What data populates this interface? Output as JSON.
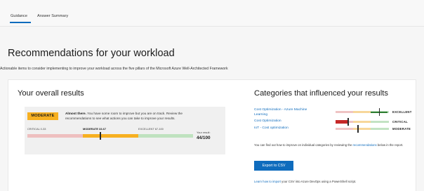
{
  "tabs": [
    {
      "label": "Guidance",
      "active": true
    },
    {
      "label": "Answer Summary",
      "active": false
    }
  ],
  "page": {
    "title": "Recommendations for your workload",
    "subtitle": "Actionable items to consider implementing to improve your workload across the five pillars of the Microsoft Azure Well-Architected Framework"
  },
  "results": {
    "title": "Your overall results",
    "badge": "MODERATE",
    "summary_bold": "Almost there.",
    "summary_rest": " You have some room to improve but you are on track. Review the recommendations to see what actions you can take to improve your results.",
    "scale": {
      "critical": "CRITICAL 0-33",
      "moderate": "MODERATE 33-67",
      "excellent": "EXCELLENT 67-100"
    },
    "your_result_label": "Your result:",
    "your_result_value": "44/100",
    "score": 44,
    "max": 100
  },
  "categories": {
    "title": "Categories that influenced your results",
    "items": [
      {
        "name": "Cost Optimization - Azure Machine",
        "name_cont": "Learning",
        "status": "EXCELLENT",
        "score": 0.82,
        "color": "#2e7d32"
      },
      {
        "name": "Cost Optimization",
        "status": "CRITICAL",
        "score": 0.24,
        "color": "#c62828"
      },
      {
        "name": "IoT - Cost optimization",
        "status": "MODERATE",
        "score": 0.42,
        "color": "#f7b021"
      }
    ],
    "note_pre": "You can find out how to improve on individual categories by reviewing the ",
    "note_link": "recommendations",
    "note_post": " below in the report.",
    "export_label": "Export to CSV",
    "import_link": "Learn how to import",
    "import_rest": " your CSV into Azure DevOps using a PowerShell script."
  },
  "colors": {
    "accent": "#0f6cbd",
    "moderate": "#f7b021",
    "critical": "#c62828",
    "excellent": "#2e7d32"
  }
}
